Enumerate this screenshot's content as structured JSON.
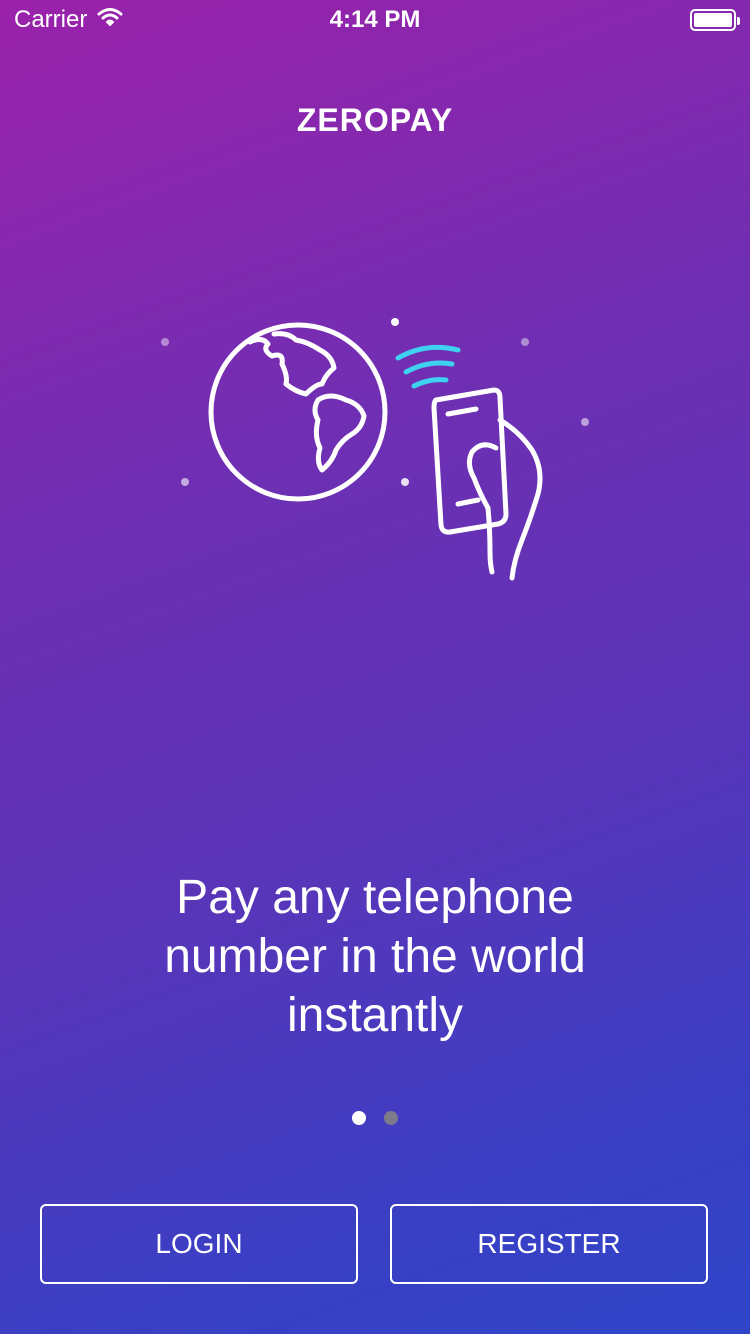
{
  "status_bar": {
    "carrier": "Carrier",
    "time": "4:14 PM"
  },
  "app": {
    "title": "ZEROPAY"
  },
  "illustration": {
    "icons": [
      "globe-icon",
      "wireless-signal-icon",
      "hand-holding-phone-icon"
    ],
    "accent_color": "#3fd2f0"
  },
  "onboarding": {
    "tagline": "Pay any telephone number in the world instantly",
    "page_count": 2,
    "active_page": 1
  },
  "actions": {
    "login_label": "LOGIN",
    "register_label": "REGISTER"
  },
  "colors": {
    "gradient_start": "#9b22aa",
    "gradient_end": "#2f45c8",
    "text": "#ffffff",
    "inactive_dot": "#7d7a8a"
  }
}
